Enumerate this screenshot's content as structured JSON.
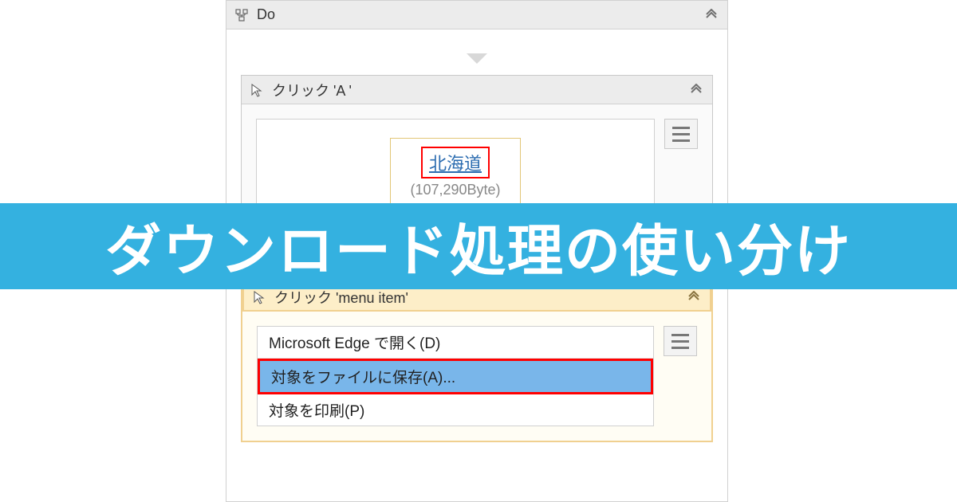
{
  "banner": {
    "text": "ダウンロード処理の使い分け"
  },
  "do_activity": {
    "title": "Do"
  },
  "click_a": {
    "title": "クリック 'A '",
    "target_label": "北海道",
    "size_text": "(107,290Byte)"
  },
  "click_menu": {
    "title": "クリック 'menu item'",
    "items": [
      {
        "label": "Microsoft Edge で開く(D)",
        "selected": false
      },
      {
        "label": "対象をファイルに保存(A)...",
        "selected": true
      },
      {
        "label": "対象を印刷(P)",
        "selected": false
      }
    ]
  }
}
